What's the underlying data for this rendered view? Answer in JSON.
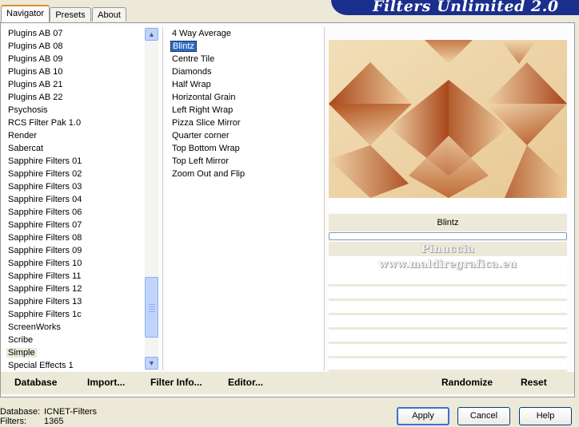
{
  "tabs": [
    "Navigator",
    "Presets",
    "About"
  ],
  "banner_title": "Filters Unlimited 2.0",
  "categories": [
    "Plugins AB 07",
    "Plugins AB 08",
    "Plugins AB 09",
    "Plugins AB 10",
    "Plugins AB 21",
    "Plugins AB 22",
    "Psychosis",
    "RCS Filter Pak 1.0",
    "Render",
    "Sabercat",
    "Sapphire Filters 01",
    "Sapphire Filters 02",
    "Sapphire Filters 03",
    "Sapphire Filters 04",
    "Sapphire Filters 06",
    "Sapphire Filters 07",
    "Sapphire Filters 08",
    "Sapphire Filters 09",
    "Sapphire Filters 10",
    "Sapphire Filters 11",
    "Sapphire Filters 12",
    "Sapphire Filters 13",
    "Sapphire Filters 1c",
    "ScreenWorks",
    "Scribe",
    "Simple",
    "Special Effects 1"
  ],
  "selected_category": "Simple",
  "filters": [
    "4 Way Average",
    "Blintz",
    "Centre Tile",
    "Diamonds",
    "Half Wrap",
    "Horizontal Grain",
    "Left Right Wrap",
    "Pizza Slice Mirror",
    "Quarter corner",
    "Top Bottom Wrap",
    "Top Left Mirror",
    "Zoom Out and Flip"
  ],
  "selected_filter": "Blintz",
  "preview_filter_name": "Blintz",
  "watermark": [
    "Pinuccia",
    "www.maldiregrafica.eu"
  ],
  "bottom_links": {
    "database": "Database",
    "import": "Import...",
    "filter_info": "Filter Info...",
    "editor": "Editor...",
    "randomize": "Randomize",
    "reset": "Reset"
  },
  "status": {
    "database_label": "Database:",
    "database_value": "ICNET-Filters",
    "filters_label": "Filters:",
    "filters_value": "1365"
  },
  "buttons": {
    "apply": "Apply",
    "cancel": "Cancel",
    "help": "Help"
  },
  "colors": {
    "accent": "#316ac5",
    "banner": "#1a2e8c",
    "tab_highlight": "#e68b2c"
  },
  "icons": {
    "scroll_up": "arrow-up-icon",
    "scroll_down": "arrow-down-icon",
    "thumb_grip": "grip-icon"
  }
}
